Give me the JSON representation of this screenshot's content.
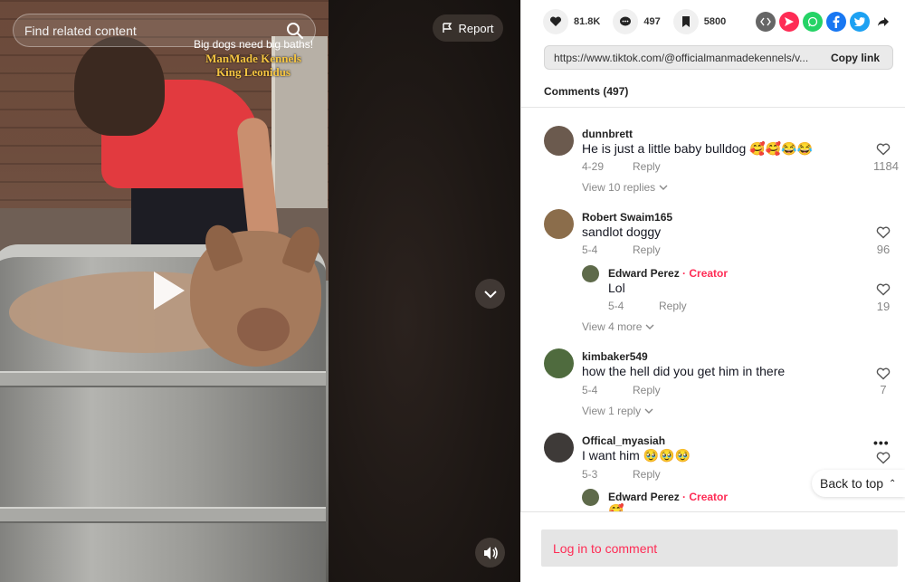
{
  "video": {
    "search_placeholder": "Find related content",
    "caption_line1": "Big dogs need big baths!",
    "caption_line2": "ManMade Kennels",
    "caption_line3": "King Leonidus",
    "report_label": "Report"
  },
  "stats": {
    "likes": "81.8K",
    "comments": "497",
    "saves": "5800"
  },
  "share": {
    "icons": [
      "embed-icon",
      "send-icon",
      "whatsapp-icon",
      "facebook-icon",
      "twitter-icon",
      "share-arrow-icon"
    ]
  },
  "link": {
    "url": "https://www.tiktok.com/@officialmanmadekennels/v...",
    "copy_label": "Copy link"
  },
  "comments_header": "Comments (497)",
  "comments": [
    {
      "user": "dunnbrett",
      "text": "He is just a little baby bulldog 🥰🥰😂😂",
      "date": "4-29",
      "reply": "Reply",
      "likes": "1184",
      "view_replies": "View 10 replies"
    },
    {
      "user": "Robert Swaim165",
      "text": "sandlot doggy",
      "date": "5-4",
      "reply": "Reply",
      "likes": "96",
      "sub": {
        "user": "Edward Perez",
        "creator_sep": " · ",
        "creator": "Creator",
        "text": "Lol",
        "date": "5-4",
        "reply": "Reply",
        "likes": "19"
      },
      "view_replies": "View 4 more"
    },
    {
      "user": "kimbaker549",
      "text": "how the hell did you get him in there",
      "date": "5-4",
      "reply": "Reply",
      "likes": "7",
      "view_replies": "View 1 reply"
    },
    {
      "user": "Offical_myasiah",
      "text": "I want him 🥹🥹🥹",
      "date": "5-3",
      "reply": "Reply",
      "sub": {
        "user": "Edward Perez",
        "creator_sep": " · ",
        "creator": "Creator",
        "text": "🥰"
      }
    }
  ],
  "back_to_top": "Back to top",
  "login_prompt": "Log in to comment",
  "colors": {
    "accent": "#fe2c55",
    "caption_gold": "#f5c542"
  }
}
